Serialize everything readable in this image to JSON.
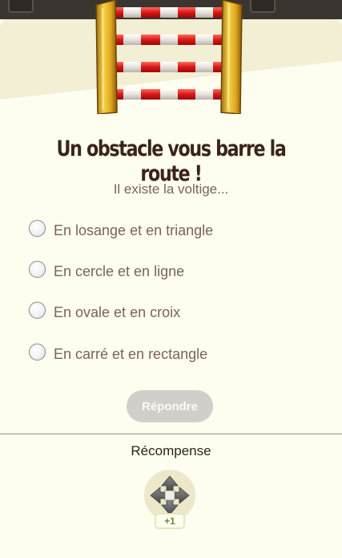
{
  "question": {
    "title": "Un obstacle vous barre la route !",
    "prompt": "Il existe la voltige..."
  },
  "options": [
    {
      "label": "En losange et en triangle",
      "selected": false
    },
    {
      "label": "En cercle et en ligne",
      "selected": false
    },
    {
      "label": "En ovale et en croix",
      "selected": false
    },
    {
      "label": "En carré et en rectangle",
      "selected": false
    }
  ],
  "answer_button": {
    "label": "Répondre",
    "enabled": false
  },
  "reward": {
    "title": "Récompense",
    "icon": "move-arrows-icon",
    "amount": "+1"
  },
  "colors": {
    "background": "#fdfdf0",
    "title": "#3a2418",
    "text": "#7a6555",
    "button_disabled": "#d1cfc9",
    "reward_badge_text": "#6a8a3a",
    "obstacle_red": "#e02020",
    "obstacle_gold": "#e8b820"
  }
}
